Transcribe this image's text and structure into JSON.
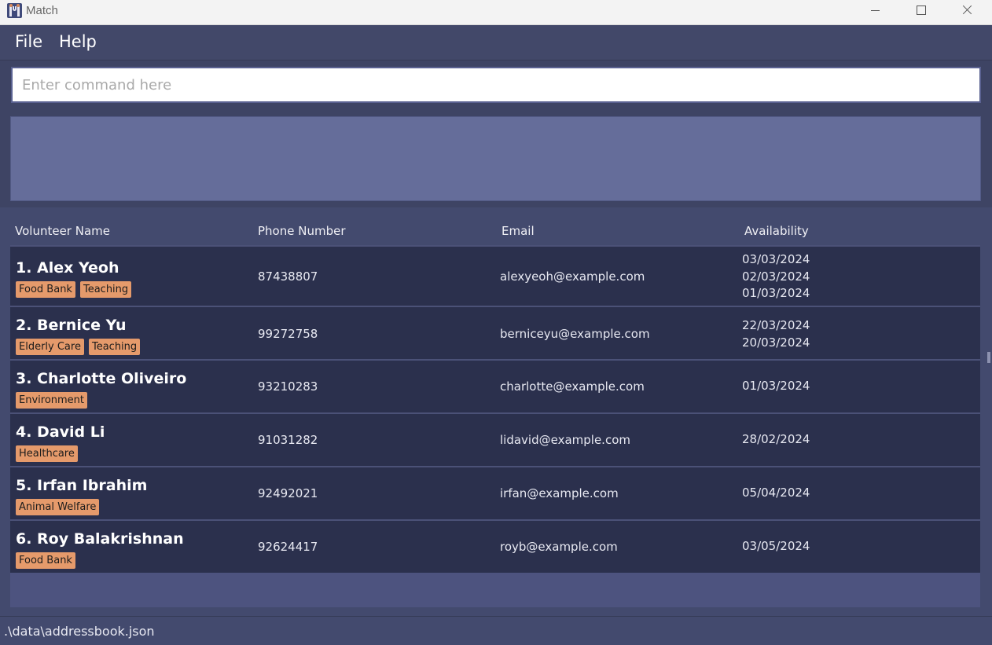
{
  "window": {
    "title": "Match"
  },
  "menu": {
    "file": "File",
    "help": "Help"
  },
  "command": {
    "placeholder": "Enter command here",
    "value": ""
  },
  "result": {
    "text": ""
  },
  "columns": {
    "name": "Volunteer Name",
    "phone": "Phone Number",
    "email": "Email",
    "availability": "Availability"
  },
  "persons": [
    {
      "name": "1. Alex Yeoh",
      "tags": [
        "Food Bank",
        "Teaching"
      ],
      "phone": "87438807",
      "email": "alexyeoh@example.com",
      "availability": [
        "03/03/2024",
        "02/03/2024",
        "01/03/2024"
      ]
    },
    {
      "name": "2. Bernice Yu",
      "tags": [
        "Elderly Care",
        "Teaching"
      ],
      "phone": "99272758",
      "email": "berniceyu@example.com",
      "availability": [
        "22/03/2024",
        "20/03/2024"
      ]
    },
    {
      "name": "3. Charlotte Oliveiro",
      "tags": [
        "Environment"
      ],
      "phone": "93210283",
      "email": "charlotte@example.com",
      "availability": [
        "01/03/2024"
      ]
    },
    {
      "name": "4. David Li",
      "tags": [
        "Healthcare"
      ],
      "phone": "91031282",
      "email": "lidavid@example.com",
      "availability": [
        "28/02/2024"
      ]
    },
    {
      "name": "5. Irfan Ibrahim",
      "tags": [
        "Animal Welfare"
      ],
      "phone": "92492021",
      "email": "irfan@example.com",
      "availability": [
        "05/04/2024"
      ]
    },
    {
      "name": "6. Roy Balakrishnan",
      "tags": [
        "Food Bank"
      ],
      "phone": "92624417",
      "email": "royb@example.com",
      "availability": [
        "03/05/2024"
      ]
    }
  ],
  "status": {
    "path": ".\\data\\addressbook.json"
  },
  "colors": {
    "background": "#3b4162",
    "row": "#2b304d",
    "tag": "#e59a6b",
    "result_box": "#656d9a"
  },
  "icons": {
    "app": "app-logo-icon",
    "minimize": "minimize-icon",
    "maximize": "maximize-icon",
    "close": "close-icon"
  }
}
